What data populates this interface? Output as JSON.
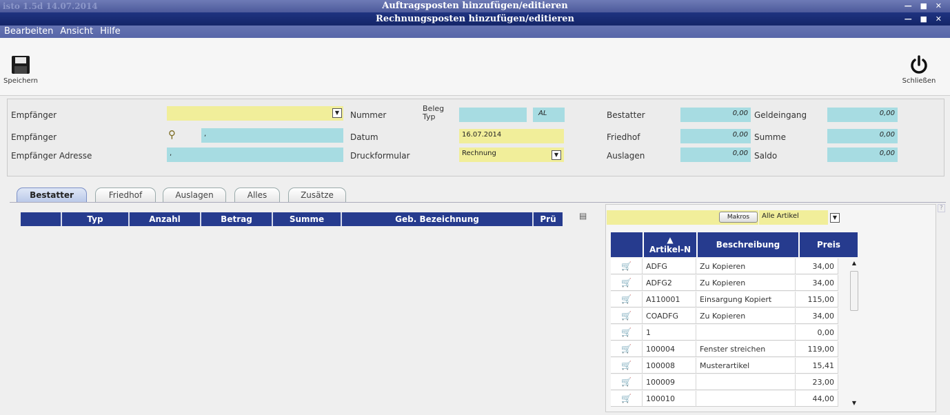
{
  "window": {
    "outer_version": "isto 1.5d 14.07.2014",
    "outer_title": "Auftragsposten hinzufügen/editieren",
    "inner_title": "Rechnungsposten hinzufügen/editieren",
    "win_buttons": "— ■ ✕"
  },
  "menu": [
    "Bearbeiten",
    "Ansicht",
    "Hilfe"
  ],
  "toolbar": {
    "save_label": "Speichern",
    "close_label": "Schließen"
  },
  "form": {
    "empfaenger_label": "Empfänger",
    "empfaenger2_label": "Empfänger",
    "empfaenger2_value": ",",
    "adresse_label": "Empfänger Adresse",
    "adresse_value": ",",
    "nummer_label": "Nummer",
    "belegtyp_label": "Beleg Typ",
    "belegtyp_value": "AL",
    "datum_label": "Datum",
    "datum_value": "16.07.2014",
    "druck_label": "Druckformular",
    "druck_value": "Rechnung",
    "bestatter_label": "Bestatter",
    "bestatter_value": "0,00",
    "friedhof_label": "Friedhof",
    "friedhof_value": "0,00",
    "auslagen_label": "Auslagen",
    "auslagen_value": "0,00",
    "geldeingang_label": "Geldeingang",
    "geldeingang_value": "0,00",
    "summe_label": "Summe",
    "summe_value": "0,00",
    "saldo_label": "Saldo",
    "saldo_value": "0,00"
  },
  "tabs": [
    "Bestatter",
    "Friedhof",
    "Auslagen",
    "Alles",
    "Zusätze"
  ],
  "left_table": {
    "headers": [
      "",
      "Typ",
      "Anzahl",
      "Betrag",
      "Summe",
      "Geb. Bezeichnung",
      "Prü"
    ]
  },
  "right": {
    "makros_label": "Makros",
    "filter_value": "Alle Artikel",
    "help_mark": "?",
    "headers": [
      "",
      "Artikel-N",
      "Beschreibung",
      "Preis"
    ],
    "sort_arrow": "▲",
    "rows": [
      {
        "nr": "ADFG",
        "desc": "Zu Kopieren",
        "price": "34,00"
      },
      {
        "nr": "ADFG2",
        "desc": "Zu Kopieren",
        "price": "34,00"
      },
      {
        "nr": "A110001",
        "desc": "Einsargung Kopiert",
        "price": "115,00"
      },
      {
        "nr": "COADFG",
        "desc": "Zu Kopieren",
        "price": "34,00"
      },
      {
        "nr": "1",
        "desc": "",
        "price": "0,00"
      },
      {
        "nr": "100004",
        "desc": "Fenster streichen",
        "price": "119,00"
      },
      {
        "nr": "100008",
        "desc": "Musterartikel",
        "price": "15,41"
      },
      {
        "nr": "100009",
        "desc": "",
        "price": "23,00"
      },
      {
        "nr": "100010",
        "desc": "",
        "price": "44,00"
      }
    ]
  }
}
